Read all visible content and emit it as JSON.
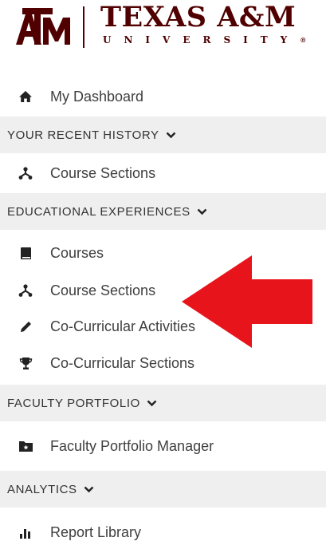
{
  "logo": {
    "mark": "ATM",
    "name": "TEXAS A&M",
    "subtitle": "UNIVERSITY",
    "registered": "®",
    "brand_color": "#500000"
  },
  "menu": {
    "dashboard": {
      "label": "My Dashboard",
      "icon": "home-icon"
    },
    "recent_history": {
      "label": "YOUR RECENT HISTORY",
      "items": [
        {
          "label": "Course Sections",
          "icon": "sitemap-icon"
        }
      ]
    },
    "educational_experiences": {
      "label": "EDUCATIONAL EXPERIENCES",
      "items": [
        {
          "label": "Courses",
          "icon": "book-icon"
        },
        {
          "label": "Course Sections",
          "icon": "sitemap-icon"
        },
        {
          "label": "Co-Curricular Activities",
          "icon": "pencil-icon"
        },
        {
          "label": "Co-Curricular Sections",
          "icon": "trophy-icon"
        }
      ]
    },
    "faculty_portfolio": {
      "label": "FACULTY PORTFOLIO",
      "items": [
        {
          "label": "Faculty Portfolio Manager",
          "icon": "folder-star-icon"
        }
      ]
    },
    "analytics": {
      "label": "ANALYTICS",
      "items": [
        {
          "label": "Report Library",
          "icon": "bar-chart-icon"
        }
      ]
    }
  },
  "annotation": {
    "color": "#e8141c"
  }
}
